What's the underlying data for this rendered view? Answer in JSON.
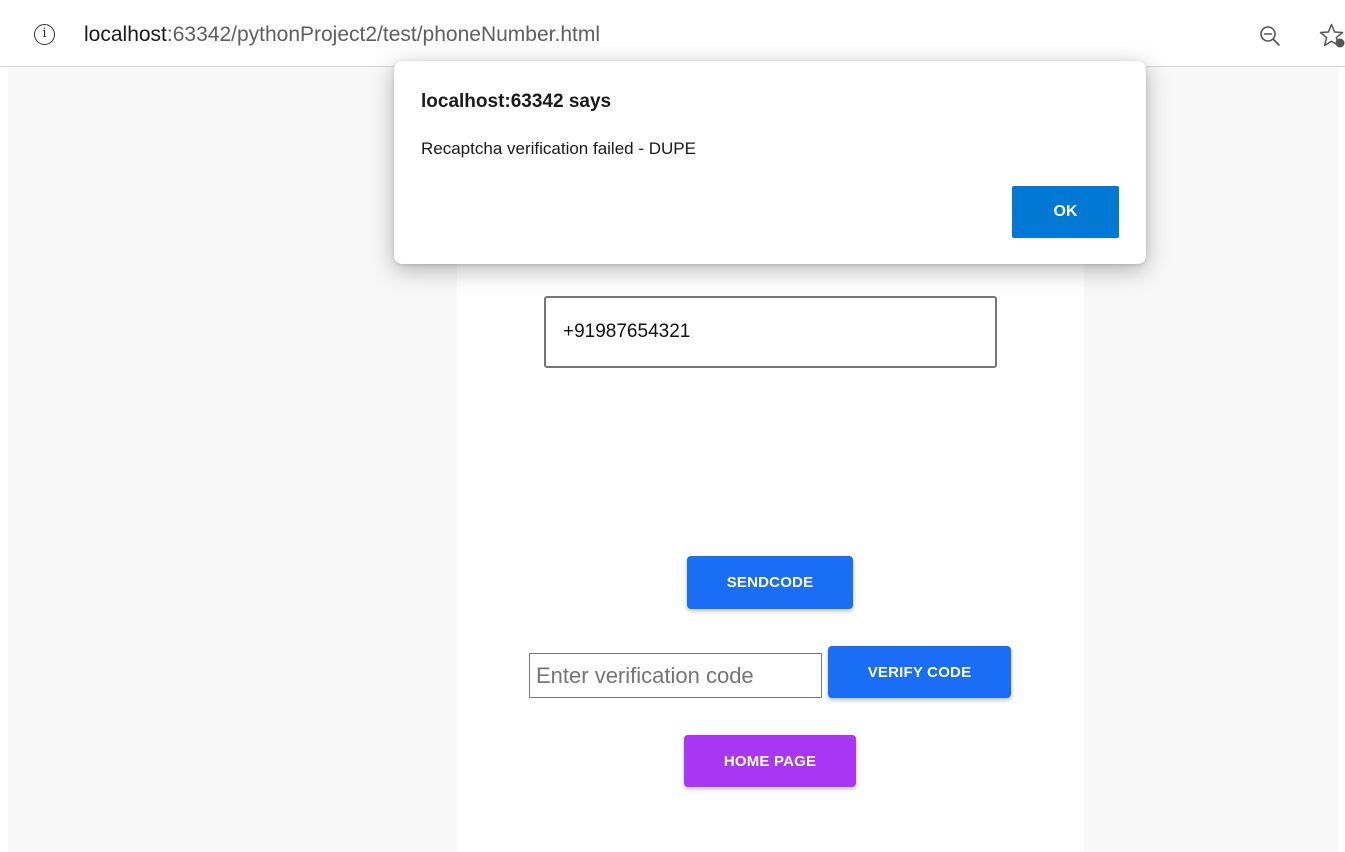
{
  "address_bar": {
    "url_host": "localhost",
    "url_rest": ":63342/pythonProject2/test/phoneNumber.html",
    "info_icon_glyph": "i",
    "icons": [
      "info-icon",
      "zoom-out-icon",
      "favorite-star-icon"
    ]
  },
  "form": {
    "phone_value": "+91987654321",
    "send_code_label": "SENDCODE",
    "verification_placeholder": "Enter verification code",
    "verify_code_label": "VERIFY CODE",
    "home_page_label": "HOME PAGE"
  },
  "alert": {
    "title": "localhost:63342 says",
    "message": "Recaptcha verification failed - DUPE",
    "ok_label": "OK"
  },
  "colors": {
    "primary_button": "#1a6ef5",
    "home_button": "#a936f5",
    "ok_button": "#0078d4",
    "page_background": "#f8f8f8",
    "card_background": "#ffffff"
  }
}
